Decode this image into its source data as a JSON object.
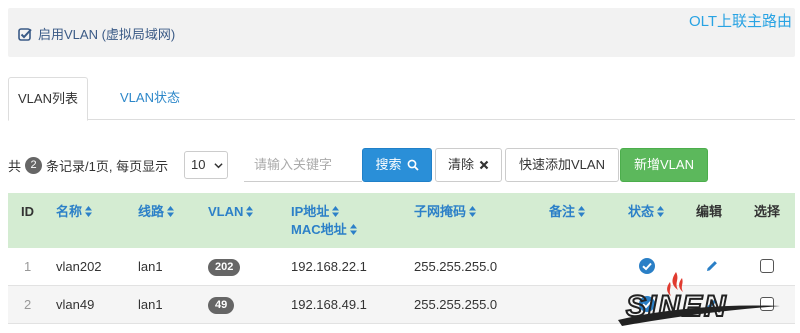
{
  "header": {
    "enable_vlan_label": "启用VLAN (虚拟局域网)",
    "page_title": "OLT上联主路由"
  },
  "tabs": [
    {
      "label": "VLAN列表",
      "active": true
    },
    {
      "label": "VLAN状态",
      "active": false
    }
  ],
  "toolbar": {
    "count_prefix": "共",
    "count": "2",
    "count_suffix": "条记录/1页, 每页显示",
    "page_size": "10",
    "search_placeholder": "请输入关键字",
    "search_label": "搜索",
    "clear_label": "清除",
    "quick_add_label": "快速添加VLAN",
    "new_label": "新增VLAN"
  },
  "table": {
    "columns": [
      "ID",
      "名称",
      "线路",
      "VLAN",
      "IP地址",
      "MAC地址",
      "子网掩码",
      "备注",
      "状态",
      "编辑",
      "选择"
    ],
    "rows": [
      {
        "id": "1",
        "name": "vlan202",
        "line": "lan1",
        "vlan": "202",
        "ip": "192.168.22.1",
        "mask": "255.255.255.0",
        "note": "",
        "status": "enabled"
      },
      {
        "id": "2",
        "name": "vlan49",
        "line": "lan1",
        "vlan": "49",
        "ip": "192.168.49.1",
        "mask": "255.255.255.0",
        "note": "",
        "status": "enabled"
      }
    ]
  },
  "watermark": {
    "text": "SINEN"
  },
  "colors": {
    "accent_blue": "#2a8fd8",
    "link_blue": "#2c80c8",
    "title_blue": "#29a3e3",
    "success_green": "#5cb85c",
    "header_green": "#d4ecd2",
    "watermark_red": "#e03a2f"
  },
  "icons": {
    "enable_checkbox": "checked-square-icon",
    "search": "search-icon",
    "clear": "close-icon",
    "status": "check-circle-icon",
    "edit": "pencil-icon",
    "sort": "sort-icon"
  }
}
